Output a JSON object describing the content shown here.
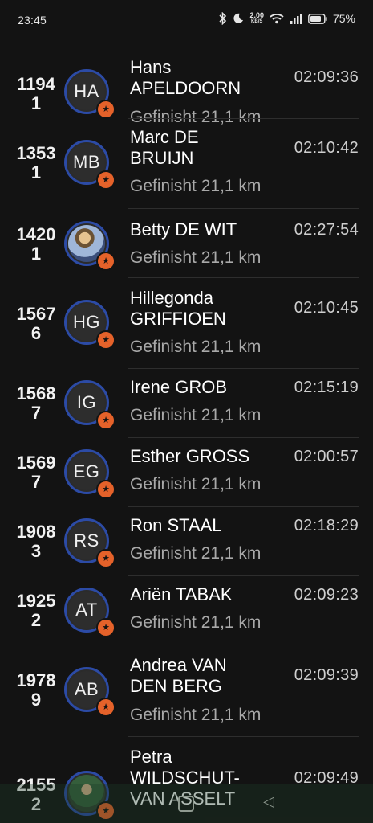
{
  "status_bar": {
    "time": "23:45",
    "net_speed": "2.00",
    "net_unit": "KB/S",
    "battery": "75%"
  },
  "status_label": "Gefinisht 21,1 km",
  "results": [
    {
      "bib_top": "1194",
      "bib_bottom": "1",
      "initials": "HA",
      "name_line1": "Hans",
      "name_line2": "APELDOORN",
      "time": "02:09:36",
      "photo": false
    },
    {
      "bib_top": "1353",
      "bib_bottom": "1",
      "initials": "MB",
      "name_line1": "Marc DE",
      "name_line2": "BRUIJN",
      "time": "02:10:42",
      "photo": false
    },
    {
      "bib_top": "1420",
      "bib_bottom": "1",
      "initials": "",
      "name_line1": "Betty DE WIT",
      "name_line2": "",
      "time": "02:27:54",
      "photo": true
    },
    {
      "bib_top": "1567",
      "bib_bottom": "6",
      "initials": "HG",
      "name_line1": "Hillegonda",
      "name_line2": "GRIFFIOEN",
      "time": "02:10:45",
      "photo": false
    },
    {
      "bib_top": "1568",
      "bib_bottom": "7",
      "initials": "IG",
      "name_line1": "Irene GROB",
      "name_line2": "",
      "time": "02:15:19",
      "photo": false
    },
    {
      "bib_top": "1569",
      "bib_bottom": "7",
      "initials": "EG",
      "name_line1": "Esther GROSS",
      "name_line2": "",
      "time": "02:00:57",
      "photo": false
    },
    {
      "bib_top": "1908",
      "bib_bottom": "3",
      "initials": "RS",
      "name_line1": "Ron STAAL",
      "name_line2": "",
      "time": "02:18:29",
      "photo": false
    },
    {
      "bib_top": "1925",
      "bib_bottom": "2",
      "initials": "AT",
      "name_line1": "Ariën TABAK",
      "name_line2": "",
      "time": "02:09:23",
      "photo": false
    },
    {
      "bib_top": "1978",
      "bib_bottom": "9",
      "initials": "AB",
      "name_line1": "Andrea VAN",
      "name_line2": "DEN BERG",
      "time": "02:09:39",
      "photo": false
    },
    {
      "bib_top": "2155",
      "bib_bottom": "2",
      "initials": "",
      "name_line1": "Petra",
      "name_line2": "WILDSCHUT-",
      "name_line3": "VAN ASSELT",
      "time": "02:09:49",
      "photo": true
    }
  ],
  "colors": {
    "background": "#131313",
    "avatar_ring": "#2c4ba6",
    "star_badge": "#e5622a"
  }
}
